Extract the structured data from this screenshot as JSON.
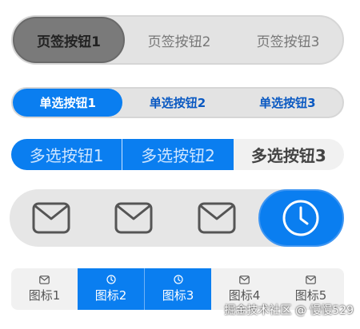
{
  "tab_segment": {
    "items": [
      {
        "label": "页签按钮1",
        "active": true
      },
      {
        "label": "页签按钮2",
        "active": false
      },
      {
        "label": "页签按钮3",
        "active": false
      }
    ]
  },
  "single_select": {
    "items": [
      {
        "label": "单选按钮1",
        "active": true
      },
      {
        "label": "单选按钮2",
        "active": false
      },
      {
        "label": "单选按钮3",
        "active": false
      }
    ]
  },
  "multi_select": {
    "items": [
      {
        "label": "多选按钮1",
        "active": true
      },
      {
        "label": "多选按钮2",
        "active": true
      },
      {
        "label": "多选按钮3",
        "active": false
      }
    ]
  },
  "icon_segment": {
    "items": [
      {
        "icon": "mail-icon",
        "active": false
      },
      {
        "icon": "mail-icon",
        "active": false
      },
      {
        "icon": "mail-icon",
        "active": false
      },
      {
        "icon": "clock-icon",
        "active": true
      }
    ]
  },
  "icon_label_segment": {
    "items": [
      {
        "icon": "mail-icon",
        "label": "图标1",
        "active": false
      },
      {
        "icon": "clock-icon",
        "label": "图标2",
        "active": true
      },
      {
        "icon": "clock-icon",
        "label": "图标3",
        "active": true
      },
      {
        "icon": "mail-icon",
        "label": "图标4",
        "active": false
      },
      {
        "icon": "mail-icon",
        "label": "图标5",
        "active": false
      }
    ]
  },
  "watermark": "掘金技术社区 @ 慢慢529",
  "colors": {
    "accent": "#0a7ef0",
    "track": "#e3e3e3",
    "tab_active": "#7a7a7a"
  }
}
